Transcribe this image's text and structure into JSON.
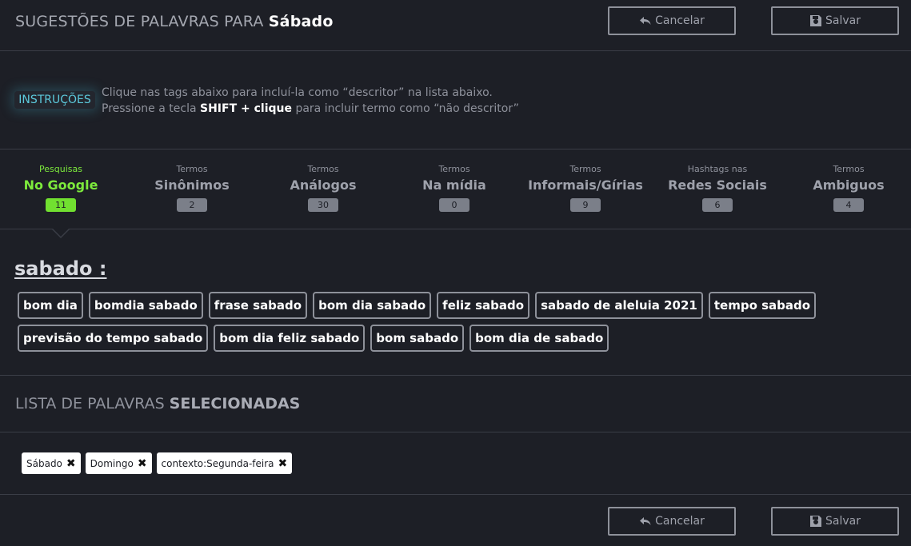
{
  "header": {
    "title_prefix": "SUGESTÕES DE PALAVRAS PARA",
    "title_word": "Sábado",
    "cancel_label": "Cancelar",
    "save_label": "Salvar"
  },
  "instructions": {
    "badge": "INSTRUÇÕES",
    "line1": "Clique nas tags abaixo para incluí-la como “descritor” na lista abaixo.",
    "line2_prefix": "Pressione a tecla",
    "line2_key": "SHIFT + clique",
    "line2_suffix": "para incluir termo como “não descritor”"
  },
  "tabs": [
    {
      "small": "Pesquisas",
      "big": "No Google",
      "count": "11",
      "active": true
    },
    {
      "small": "Termos",
      "big": "Sinônimos",
      "count": "2",
      "active": false
    },
    {
      "small": "Termos",
      "big": "Análogos",
      "count": "30",
      "active": false
    },
    {
      "small": "Termos",
      "big": "Na mídia",
      "count": "0",
      "active": false
    },
    {
      "small": "Termos",
      "big": "Informais/Gírias",
      "count": "9",
      "active": false
    },
    {
      "small": "Hashtags nas",
      "big": "Redes Sociais",
      "count": "6",
      "active": false
    },
    {
      "small": "Termos",
      "big": "Ambiguos",
      "count": "4",
      "active": false
    }
  ],
  "suggestions": {
    "heading": "sabado :",
    "chips": [
      "bom dia",
      "bomdia sabado",
      "frase sabado",
      "bom dia sabado",
      "feliz sabado",
      "sabado de aleluia 2021",
      "tempo sabado",
      "previsão do tempo sabado",
      "bom dia feliz sabado",
      "bom sabado",
      "bom dia de sabado"
    ]
  },
  "selected": {
    "title_prefix": "LISTA DE PALAVRAS",
    "title_bold": "SELECIONADAS",
    "items": [
      "Sábado",
      "Domingo",
      "contexto:Segunda-feira"
    ],
    "remove_glyph": "✖"
  },
  "footer": {
    "cancel_label": "Cancelar",
    "save_label": "Salvar"
  },
  "icons": {
    "cancel": "undo-arrow-icon",
    "save": "floppy-disk-icon"
  },
  "colors": {
    "background": "#1d1f26",
    "accent_green": "#71e030",
    "accent_cyan": "#5cc9dc",
    "border": "#8e919a"
  }
}
